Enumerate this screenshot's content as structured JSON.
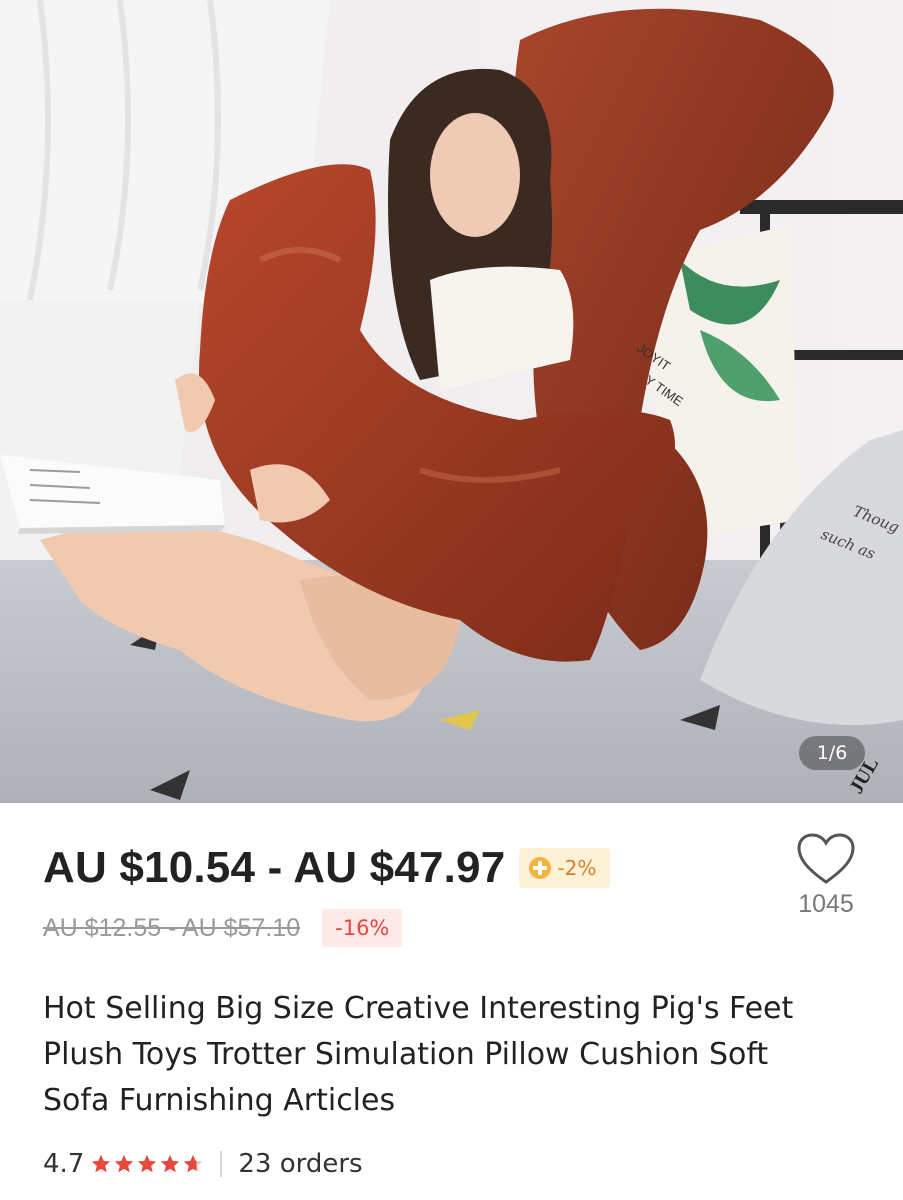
{
  "gallery": {
    "counter": "1/6",
    "pillow_print_1": "JOYIT",
    "pillow_print_2": "Y TIME",
    "cushion_text_1": "Thoug",
    "cushion_text_2": "such as",
    "blanket_text": "JUL"
  },
  "price": {
    "range": "AU $10.54 - AU $47.97",
    "coin_discount": "-2%",
    "original_range": "AU $12.55 - AU $57.10",
    "discount": "-16%"
  },
  "wishlist": {
    "count": "1045"
  },
  "product": {
    "title": "Hot Selling Big Size Creative Interesting Pig's Feet Plush Toys Trotter Simulation Pillow Cushion Soft Sofa Furnishing Articles"
  },
  "rating": {
    "value": "4.7",
    "stars": 4.7,
    "orders": "23 orders"
  },
  "colors": {
    "star": "#e8473c",
    "discount": "#e8473c",
    "coin": "#f5b342"
  }
}
